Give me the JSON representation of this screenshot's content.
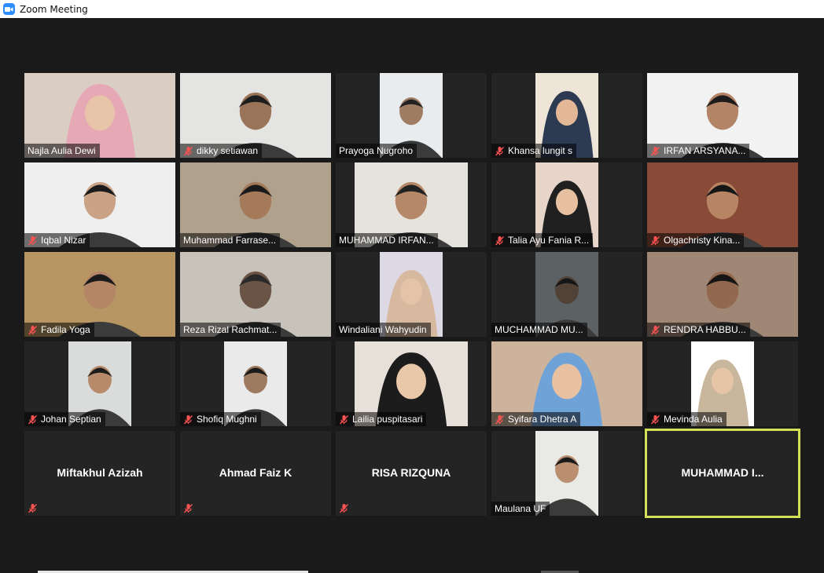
{
  "window": {
    "title": "Zoom Meeting"
  },
  "colors": {
    "active_speaker": "#d4e157",
    "muted_icon": "#e53935"
  },
  "participants": [
    {
      "name": "Najla Aulia Dewi",
      "muted": false,
      "video": true,
      "bg": "#d9cdc4",
      "skin": "#e8c4a8",
      "hijab": "#e6a8b5"
    },
    {
      "name": "dikky setiawan",
      "muted": true,
      "video": true,
      "bg": "#e4e4e2",
      "skin": "#9a7459",
      "hair": "#1d1d1d"
    },
    {
      "name": "Prayoga Nugroho",
      "muted": false,
      "video": true,
      "bg": "#e8ecee",
      "skin": "#a07c63",
      "hair": "#222"
    },
    {
      "name": "Khansa lungit s",
      "muted": true,
      "video": true,
      "bg": "#efe4d8",
      "skin": "#e2b896",
      "hijab": "#2c3a52"
    },
    {
      "name": "IRFAN ARSYANA...",
      "muted": true,
      "video": true,
      "bg": "#f2f2f2",
      "skin": "#b48466",
      "hair": "#1c1c1c"
    },
    {
      "name": "Iqbal Nizar",
      "muted": true,
      "video": true,
      "bg": "#efefef",
      "skin": "#caa286",
      "hair": "#1b1b1b"
    },
    {
      "name": "Muhammad Farrase...",
      "muted": false,
      "video": true,
      "bg": "#b0a18c",
      "skin": "#a47a5b",
      "hair": "#1a1a1a"
    },
    {
      "name": "MUHAMMAD IRFAN...",
      "muted": false,
      "video": true,
      "bg": "#e6e2dc",
      "skin": "#b48868",
      "hair": "#222"
    },
    {
      "name": "Talia Ayu Fania R...",
      "muted": true,
      "video": true,
      "bg": "#e6d5c8",
      "skin": "#e6c0a0",
      "hijab": "#202020"
    },
    {
      "name": "Olgachristy Kina...",
      "muted": true,
      "video": true,
      "bg": "#8a4a38",
      "skin": "#b78464",
      "hair": "#161616"
    },
    {
      "name": "Fadila Yoga",
      "muted": true,
      "video": true,
      "bg": "#b79663",
      "skin": "#b58666",
      "hair": "#1b1b1b"
    },
    {
      "name": "Reza Rizal Rachmat...",
      "muted": false,
      "video": true,
      "bg": "#c7c2ba",
      "skin": "#6a5446",
      "hair": "#2a2a2a"
    },
    {
      "name": "Windaliani Wahyudin",
      "muted": false,
      "video": true,
      "bg": "#dcd8e4",
      "skin": "#e4c3a6",
      "hijab": "#d7b9a0"
    },
    {
      "name": "MUCHAMMAD MU...",
      "muted": false,
      "video": true,
      "bg": "#5c6264",
      "skin": "#514238",
      "hair": "#151515"
    },
    {
      "name": "RENDRA HABBU...",
      "muted": true,
      "video": true,
      "bg": "#a08674",
      "skin": "#92684e",
      "hair": "#161616"
    },
    {
      "name": "Johan Septian",
      "muted": true,
      "video": true,
      "bg": "#d9dcda",
      "skin": "#b78a6a",
      "hair": "#1c1c1c"
    },
    {
      "name": "Shofiq Mughni",
      "muted": true,
      "video": true,
      "bg": "#eaeaea",
      "skin": "#9e7a60",
      "hair": "#1b1b1b"
    },
    {
      "name": "Lailia puspitasari",
      "muted": true,
      "video": true,
      "bg": "#e6e0d8",
      "skin": "#e9c7a9",
      "hijab": "#1c1c1c"
    },
    {
      "name": "Syifara Dhetra A",
      "muted": true,
      "video": true,
      "bg": "#cdb39c",
      "skin": "#e7c1a2",
      "hijab": "#6fa3d8"
    },
    {
      "name": "Mevinda Aulia",
      "muted": true,
      "video": true,
      "bg": "#ffffff",
      "skin": "#e6c4a6",
      "hijab": "#c9b79d"
    },
    {
      "name": "Miftakhul Azizah",
      "muted": true,
      "video": false
    },
    {
      "name": "Ahmad Faiz K",
      "muted": true,
      "video": false
    },
    {
      "name": "RISA RIZQUNA",
      "muted": true,
      "video": false
    },
    {
      "name": "Maulana UF",
      "muted": false,
      "video": true,
      "bg": "#e9e9e6",
      "skin": "#b98f70",
      "hair": "#1a1a1a"
    },
    {
      "name": "MUHAMMAD  I...",
      "muted": false,
      "video": false,
      "active": true
    }
  ]
}
